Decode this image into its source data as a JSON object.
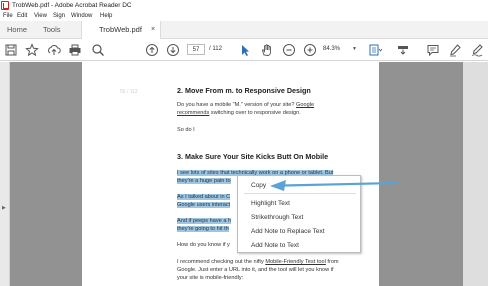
{
  "window": {
    "title": "TrobWeb.pdf - Adobe Acrobat Reader DC"
  },
  "menubar": {
    "items": [
      "File",
      "Edit",
      "View",
      "Sign",
      "Window",
      "Help"
    ]
  },
  "tabs": {
    "home": "Home",
    "tools": "Tools",
    "document": "TrobWeb.pdf",
    "close": "×"
  },
  "toolbar": {
    "page_current": "57",
    "page_total": "/ 112",
    "zoom": "84.3%",
    "zoom_dropdown": "▼"
  },
  "page": {
    "page_label": "56 / 112",
    "section2_heading": "2. Move From m. to Responsive Design",
    "s2_line1_pre": "Do you have a mobile \"M.\" version of your site? ",
    "s2_line1_link": "Google",
    "s2_line2_link": "recommends",
    "s2_line2_post": " switching over to responsive design.",
    "s2_line3": "So do I",
    "section3_heading": "3. Make Sure Your Site Kicks Butt On Mobile",
    "hl_line1": "I see lots of sites that technically work on a phone or tablet. But",
    "hl_line2": "they're a huge pain to",
    "hl_line3": "As I talked about in C",
    "hl_line4": "Google users interact",
    "hl_line5": "And if peeps have a h",
    "hl_line6": "they're going to hit th",
    "para_howdo": "How do you know if y",
    "para_a_pre": "I recommend checking out the nifty ",
    "para_a_link": "Mobile-Friendly Test tool",
    "para_a_post": " from",
    "para_b": "Google. Just enter a URL into it, and the tool will let you know if",
    "para_c": "your site is mobile-friendly:"
  },
  "context_menu": {
    "items": [
      "Copy",
      "Highlight Text",
      "Strikethrough Text",
      "Add Note to Replace Text",
      "Add Note to Text"
    ]
  },
  "colors": {
    "selection": "#9cc6e3",
    "annotation_arrow": "#5aa3d6"
  }
}
